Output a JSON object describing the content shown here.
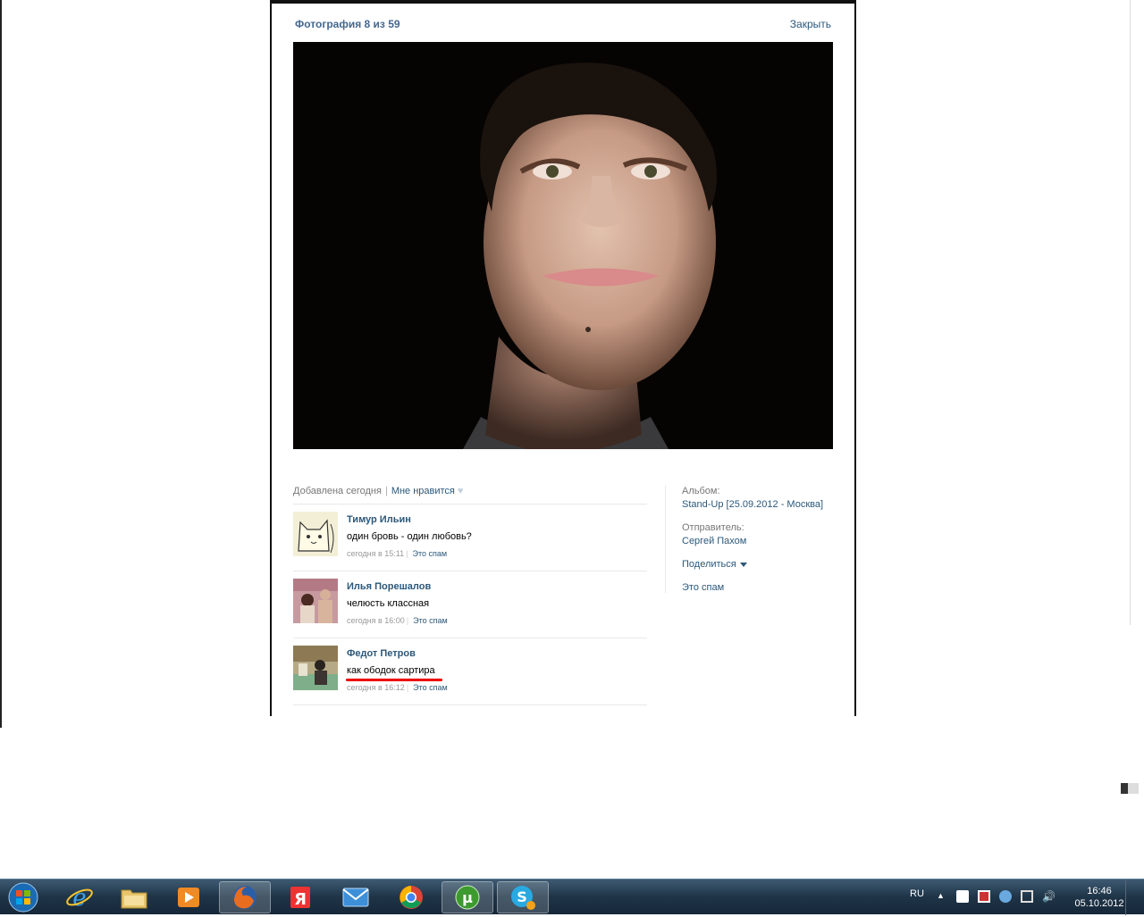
{
  "viewer": {
    "counter": "Фотография 8 из 59",
    "close": "Закрыть"
  },
  "meta": {
    "added": "Добавлена сегодня",
    "like": "Мне нравится"
  },
  "comments": [
    {
      "author": "Тимур Ильин",
      "text": "один бровь - один любовь?",
      "time": "сегодня в 15:11",
      "spam": "Это спам"
    },
    {
      "author": "Илья Порешалов",
      "text": "челюсть классная",
      "time": "сегодня в 16:00",
      "spam": "Это спам"
    },
    {
      "author": "Федот Петров",
      "text": "как ободок сартира",
      "time": "сегодня в 16:12",
      "spam": "Это спам"
    }
  ],
  "sidebar": {
    "album_label": "Альбом:",
    "album": "Stand-Up [25.09.2012 - Москва]",
    "sender_label": "Отправитель:",
    "sender": "Сергей Пахом",
    "share": "Поделиться",
    "spam": "Это спам"
  },
  "taskbar": {
    "apps": [
      "windows-start",
      "internet-explorer",
      "file-explorer",
      "media-player",
      "firefox",
      "yandex",
      "mail",
      "chrome",
      "utorrent",
      "skype"
    ],
    "lang": "RU",
    "time": "16:46",
    "date": "05.10.2012"
  },
  "colors": {
    "link": "#2b587a",
    "title": "#45688e",
    "highlight": "#e00000"
  }
}
